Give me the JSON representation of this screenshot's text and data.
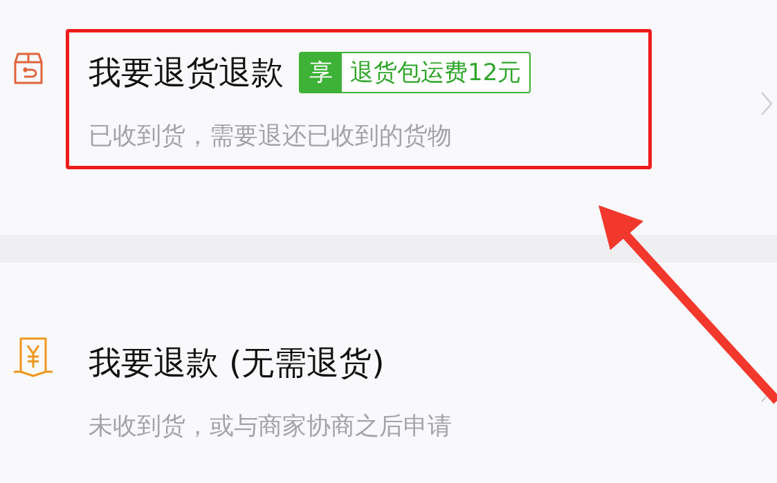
{
  "options": [
    {
      "kind": "return-box",
      "title": "我要退货退款",
      "badge": {
        "prefix": "享",
        "text": "退货包运费12元"
      },
      "subtitle": "已收到货，需要退还已收到的货物",
      "highlighted": true
    },
    {
      "kind": "refund",
      "title": "我要退款 (无需退货)",
      "subtitle": "未收到货，或与商家协商之后申请",
      "highlighted": false
    }
  ]
}
